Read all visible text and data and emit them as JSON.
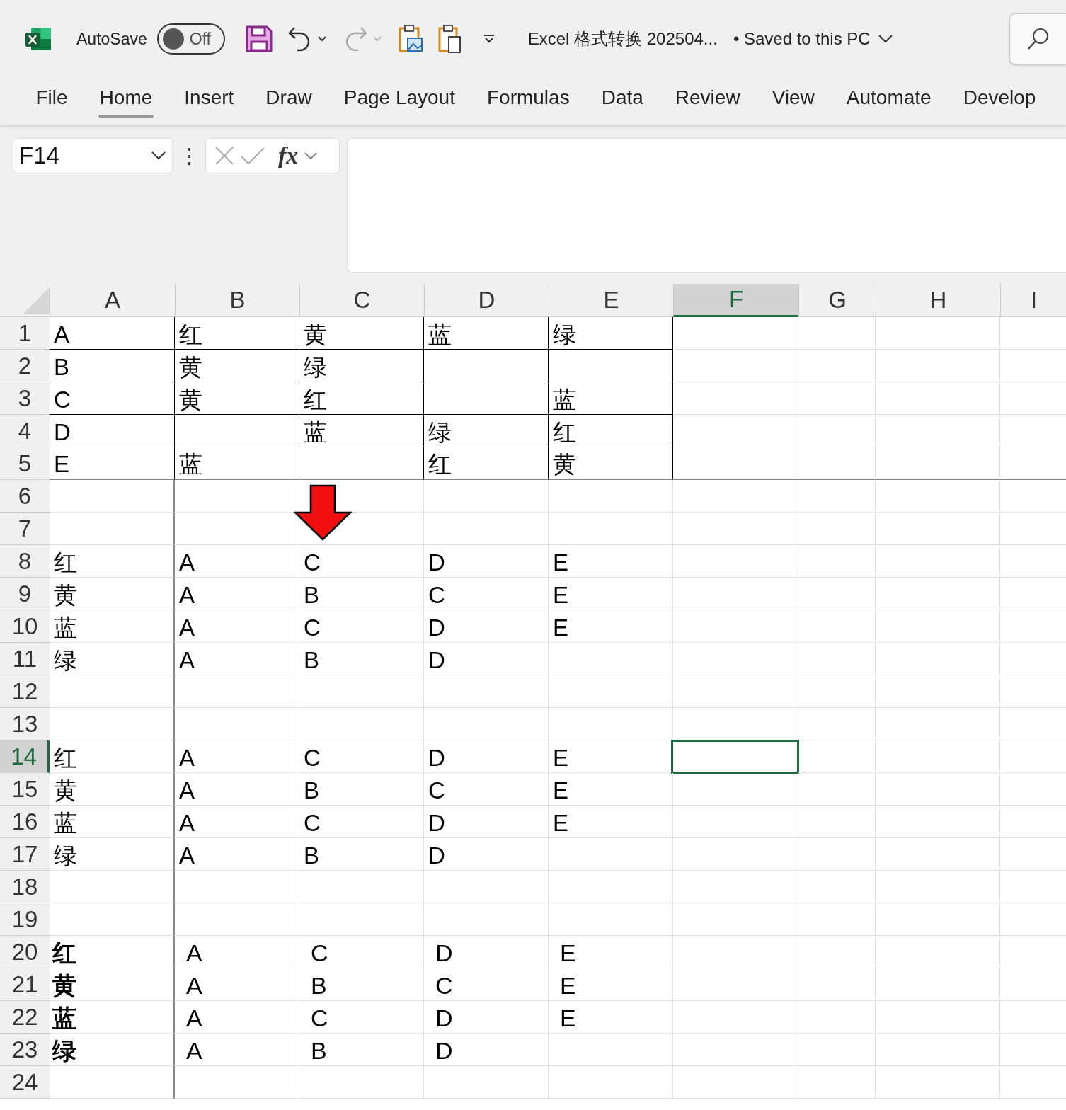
{
  "titlebar": {
    "autosave_label": "AutoSave",
    "autosave": {
      "on": false,
      "label": "Off"
    },
    "file_title": "Excel 格式转换 202504...",
    "save_status": "• Saved to this PC"
  },
  "ribbon_tabs": [
    {
      "label": "File",
      "selected": false
    },
    {
      "label": "Home",
      "selected": true
    },
    {
      "label": "Insert",
      "selected": false
    },
    {
      "label": "Draw",
      "selected": false
    },
    {
      "label": "Page Layout",
      "selected": false
    },
    {
      "label": "Formulas",
      "selected": false
    },
    {
      "label": "Data",
      "selected": false
    },
    {
      "label": "Review",
      "selected": false
    },
    {
      "label": "View",
      "selected": false
    },
    {
      "label": "Automate",
      "selected": false
    },
    {
      "label": "Develop",
      "selected": false
    }
  ],
  "formula_bar": {
    "name_box": "F14",
    "fx": "fx"
  },
  "columns": [
    {
      "label": "A",
      "selected": false
    },
    {
      "label": "B",
      "selected": false
    },
    {
      "label": "C",
      "selected": false
    },
    {
      "label": "D",
      "selected": false
    },
    {
      "label": "E",
      "selected": false
    },
    {
      "label": "F",
      "selected": true
    },
    {
      "label": "G",
      "selected": false
    },
    {
      "label": "H",
      "selected": false
    },
    {
      "label": "I",
      "selected": false
    }
  ],
  "rows": [
    {
      "label": "1",
      "kind": "bordered",
      "selected": false,
      "cells": {
        "A": "A",
        "B": "红",
        "C": "黄",
        "D": "蓝",
        "E": "绿"
      }
    },
    {
      "label": "2",
      "kind": "bordered",
      "selected": false,
      "cells": {
        "A": "B",
        "B": "黄",
        "C": "绿"
      }
    },
    {
      "label": "3",
      "kind": "bordered",
      "selected": false,
      "cells": {
        "A": "C",
        "B": "黄",
        "C": "红",
        "E": "蓝"
      }
    },
    {
      "label": "4",
      "kind": "bordered",
      "selected": false,
      "cells": {
        "A": "D",
        "C": "蓝",
        "D": "绿",
        "E": "红"
      }
    },
    {
      "label": "5",
      "kind": "bordered",
      "selected": false,
      "cells": {
        "A": "E",
        "B": "蓝",
        "D": "红",
        "E": "黄"
      }
    },
    {
      "label": "6",
      "kind": "plain",
      "selected": false,
      "cells": {}
    },
    {
      "label": "7",
      "kind": "plain",
      "selected": false,
      "cells": {}
    },
    {
      "label": "8",
      "kind": "plain",
      "selected": false,
      "cells": {
        "A": "红",
        "B": "A",
        "C": "C",
        "D": "D",
        "E": "E"
      }
    },
    {
      "label": "9",
      "kind": "plain",
      "selected": false,
      "cells": {
        "A": "黄",
        "B": "A",
        "C": "B",
        "D": "C",
        "E": "E"
      }
    },
    {
      "label": "10",
      "kind": "plain",
      "selected": false,
      "cells": {
        "A": "蓝",
        "B": "A",
        "C": "C",
        "D": "D",
        "E": "E"
      }
    },
    {
      "label": "11",
      "kind": "plain",
      "selected": false,
      "cells": {
        "A": "绿",
        "B": "A",
        "C": "B",
        "D": "D"
      }
    },
    {
      "label": "12",
      "kind": "plain",
      "selected": false,
      "cells": {}
    },
    {
      "label": "13",
      "kind": "plain",
      "selected": false,
      "cells": {}
    },
    {
      "label": "14",
      "kind": "plain",
      "selected": true,
      "cells": {
        "A": "红",
        "B": "A",
        "C": "C",
        "D": "D",
        "E": "E"
      }
    },
    {
      "label": "15",
      "kind": "plain",
      "selected": false,
      "cells": {
        "A": "黄",
        "B": "A",
        "C": "B",
        "D": "C",
        "E": "E"
      }
    },
    {
      "label": "16",
      "kind": "plain",
      "selected": false,
      "cells": {
        "A": "蓝",
        "B": "A",
        "C": "C",
        "D": "D",
        "E": "E"
      }
    },
    {
      "label": "17",
      "kind": "plain",
      "selected": false,
      "cells": {
        "A": "绿",
        "B": "A",
        "C": "B",
        "D": "D"
      }
    },
    {
      "label": "18",
      "kind": "plain",
      "selected": false,
      "cells": {}
    },
    {
      "label": "19",
      "kind": "plain",
      "selected": false,
      "cells": {}
    },
    {
      "label": "20",
      "kind": "padded",
      "selected": false,
      "cells": {
        "A": "红",
        "B": "A",
        "C": "C",
        "D": "D",
        "E": "E"
      }
    },
    {
      "label": "21",
      "kind": "padded",
      "selected": false,
      "cells": {
        "A": "黄",
        "B": "A",
        "C": "B",
        "D": "C",
        "E": "E"
      }
    },
    {
      "label": "22",
      "kind": "padded",
      "selected": false,
      "cells": {
        "A": "蓝",
        "B": "A",
        "C": "C",
        "D": "D",
        "E": "E"
      }
    },
    {
      "label": "23",
      "kind": "padded",
      "selected": false,
      "cells": {
        "A": "绿",
        "B": "A",
        "C": "B",
        "D": "D"
      }
    },
    {
      "label": "24",
      "kind": "plain",
      "selected": false,
      "cells": {}
    }
  ]
}
